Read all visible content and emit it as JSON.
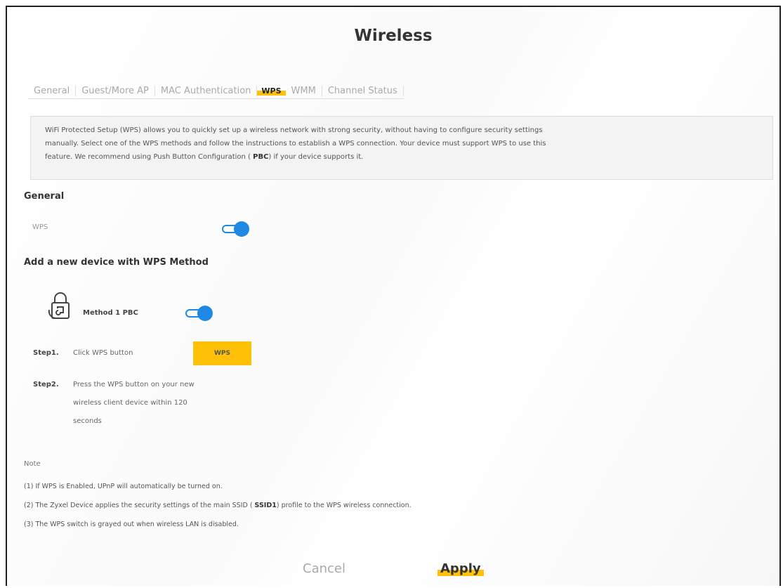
{
  "page": {
    "title": "Wireless"
  },
  "tabs": [
    {
      "label": "General"
    },
    {
      "label": "Guest/More AP"
    },
    {
      "label": "MAC Authentication"
    },
    {
      "label": "WPS"
    },
    {
      "label": "WMM"
    },
    {
      "label": "Channel Status"
    }
  ],
  "info": {
    "line1": "WiFi Protected Setup (WPS) allows you to quickly set up a wireless network with strong security, without having to configure security settings",
    "line2": "manually. Select one of the WPS methods and follow the instructions to establish a WPS connection. Your device must support WPS to use this",
    "line3_pre": "feature. We recommend using Push Button Configuration ( ",
    "line3_bold": "PBC",
    "line3_post": ") if your device supports it."
  },
  "general": {
    "heading": "General",
    "wps_label": "WPS",
    "wps_enabled": true
  },
  "add_device": {
    "heading": "Add a new device with WPS Method",
    "method_label": "Method 1 PBC",
    "method_enabled": true,
    "step1_title": "Step1.",
    "step1_text": "Click WPS button",
    "wps_button_label": "WPS",
    "step2_title": "Step2.",
    "step2_line1": "Press the WPS button on your new",
    "step2_line2": "wireless client device within 120",
    "step2_line3": "seconds"
  },
  "notes": {
    "title": "Note",
    "line1": "(1) If WPS is Enabled, UPnP will automatically be turned on.",
    "line2_pre": "(2) The Zyxel Device applies the security settings of the main SSID ( ",
    "line2_bold": "SSID1",
    "line2_post": ") profile to the WPS wireless connection.",
    "line3": "(3) The WPS switch is grayed out when wireless LAN is disabled."
  },
  "actions": {
    "cancel": "Cancel",
    "apply": "Apply"
  },
  "colors": {
    "accent": "#ffc107",
    "toggle": "#1e88e5"
  }
}
